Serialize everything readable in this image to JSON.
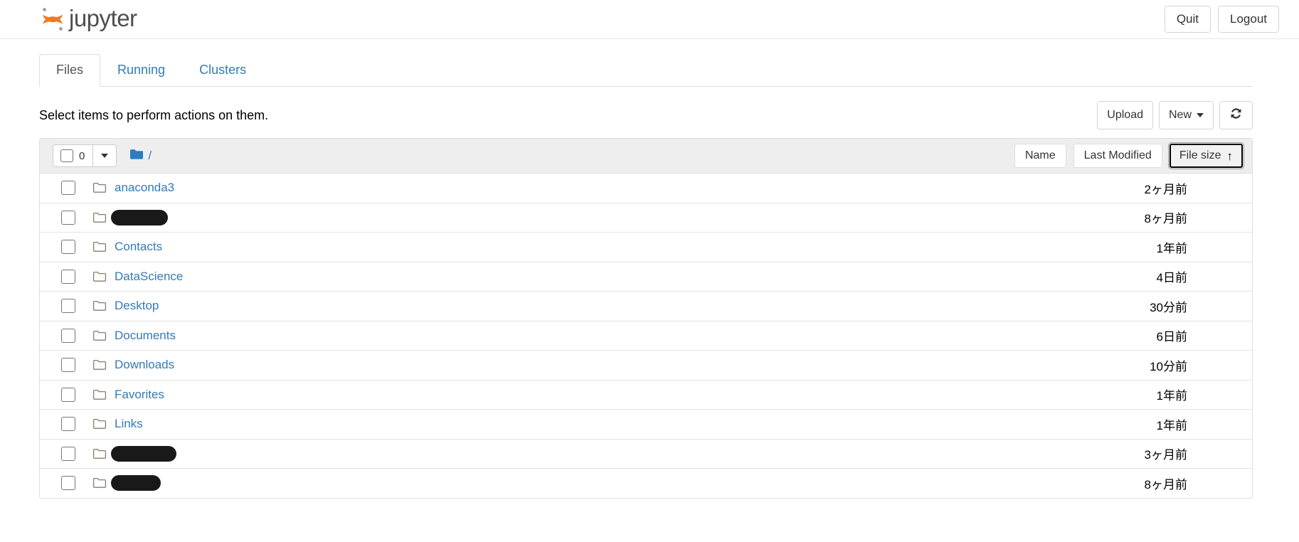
{
  "header": {
    "brand_text": "jupyter",
    "quit_label": "Quit",
    "logout_label": "Logout"
  },
  "tabs": [
    {
      "label": "Files",
      "active": true
    },
    {
      "label": "Running",
      "active": false
    },
    {
      "label": "Clusters",
      "active": false
    }
  ],
  "toolbar": {
    "message": "Select items to perform actions on them.",
    "upload_label": "Upload",
    "new_label": "New",
    "refresh_icon": "refresh-icon"
  },
  "list_header": {
    "selected_count": "0",
    "breadcrumb_root": "/",
    "folder_icon": "folder-icon",
    "sort_name": "Name",
    "sort_last_modified": "Last Modified",
    "sort_file_size": "File size",
    "sort_file_size_arrow": "↑",
    "sort_active": "File size"
  },
  "rows": [
    {
      "name": "anaconda3",
      "redacted": false,
      "redact_width": 0,
      "time": "2ヶ月前"
    },
    {
      "name": "",
      "redacted": true,
      "redact_width": 80,
      "time": "8ヶ月前"
    },
    {
      "name": "Contacts",
      "redacted": false,
      "redact_width": 0,
      "time": "1年前"
    },
    {
      "name": "DataScience",
      "redacted": false,
      "redact_width": 0,
      "time": "4日前"
    },
    {
      "name": "Desktop",
      "redacted": false,
      "redact_width": 0,
      "time": "30分前"
    },
    {
      "name": "Documents",
      "redacted": false,
      "redact_width": 0,
      "time": "6日前"
    },
    {
      "name": "Downloads",
      "redacted": false,
      "redact_width": 0,
      "time": "10分前"
    },
    {
      "name": "Favorites",
      "redacted": false,
      "redact_width": 0,
      "time": "1年前"
    },
    {
      "name": "Links",
      "redacted": false,
      "redact_width": 0,
      "time": "1年前"
    },
    {
      "name": "",
      "redacted": true,
      "redact_width": 92,
      "time": "3ヶ月前"
    },
    {
      "name": "",
      "redacted": true,
      "redact_width": 70,
      "time": "8ヶ月前"
    }
  ],
  "colors": {
    "link": "#337ab7",
    "brand_orange": "#f37726",
    "brand_gray": "#9e9e9e",
    "folder_blue": "#2b7cc0",
    "header_bg": "#eeeeee",
    "redaction": "#191919"
  }
}
